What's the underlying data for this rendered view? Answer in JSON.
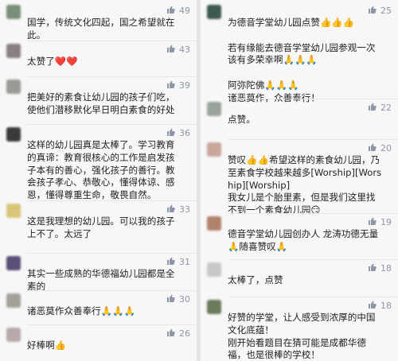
{
  "left_comments": [
    {
      "text": "国学，传统文化四起，国之希望就在此。",
      "likes": "49",
      "avatar_color": "#7a8f7a"
    },
    {
      "text": "太赞了❤️❤️",
      "likes": "43",
      "avatar_color": "#8a7f83"
    },
    {
      "text": "把美好的素食让幼儿园的孩子们吃，使他们潜移默化早日明白素食的好处",
      "likes": "39",
      "avatar_color": "#9b9994"
    },
    {
      "text": "这样的幼儿园真是太棒了。学习教育的真谛：教育很核心的工作是启发孩子本有的善心，强化孩子的善行。教会孩子孝心、恭敬心，懂得体谅、感恩，懂得尊重生命，敬畏自然。",
      "likes": "36",
      "avatar_color": "#3a3a3a"
    },
    {
      "text": "这是我理想的幼儿园。可以我的孩子上不了。太远了",
      "likes": "33",
      "avatar_color": "#d9c67a"
    },
    {
      "text": "其实一些成熟的华德福幼儿园都是全素的",
      "likes": "31",
      "avatar_color": "#5c4f78"
    },
    {
      "text": "诸恶莫作众善奉行🙏🙏🙏",
      "likes": "30",
      "avatar_color": "#a59f99"
    },
    {
      "text": "好棒啊👍",
      "likes": "26",
      "avatar_color": "#b7a9a9"
    }
  ],
  "right_comments": [
    {
      "text": "为德音学堂幼儿园点赞👍👍👍\n\n若有缘能去德音学堂幼儿园参观一次该有多荣幸啊🙏🙏🙏\n\n阿弥陀佛🙏🙏🙏\n诸恶莫作，众善奉行！",
      "likes": "25",
      "avatar_color": "#3d5a4e"
    },
    {
      "text": "点赞。",
      "likes": "22",
      "avatar_color": "#9aa39a"
    },
    {
      "text": "赞叹👍👍希望这样的素食幼儿园，乃至素食学校越来越多[Worship][Worship][Worship]\n我女儿是个胎里素，但是我们这里找不到一个素食幼儿园😏",
      "likes": "20",
      "avatar_color": "#c9a59a"
    },
    {
      "text": "德音学堂幼儿园创办人 龙涛功德无量🙏随喜赞叹🙏",
      "likes": "19",
      "avatar_color": "#b0846c"
    },
    {
      "text": "太棒了，点赞",
      "likes": "18",
      "avatar_color": "#c8c8c8"
    },
    {
      "text": "好赞的学堂，让人感受到浓厚的中国文化底蕴！\n刚开始看题目在猜可能是成都华德福，也是很棒的学校！",
      "likes": "18",
      "avatar_color": "#6b7a5a"
    }
  ]
}
